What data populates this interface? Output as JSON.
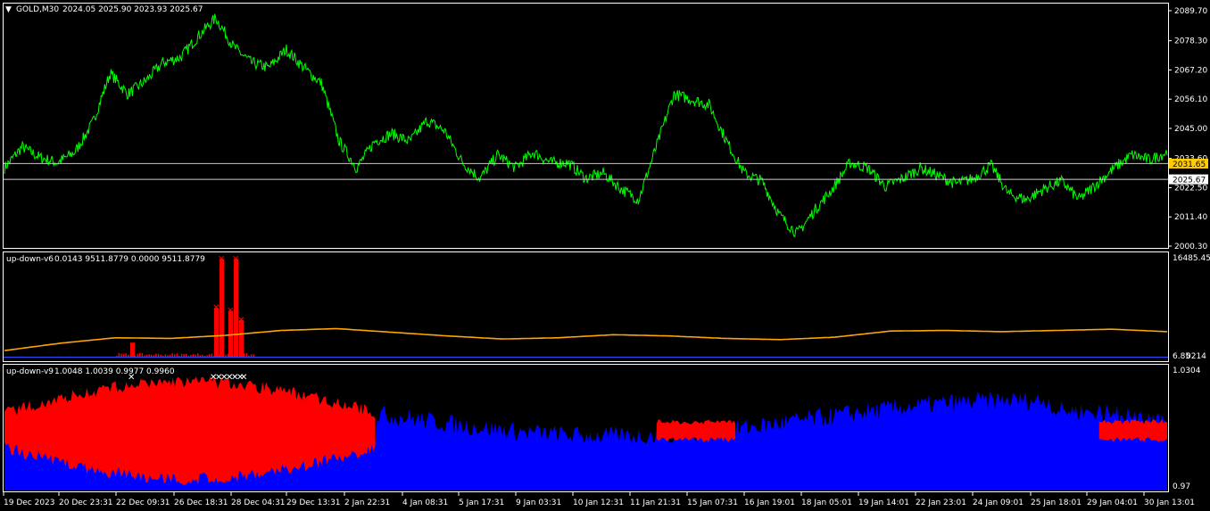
{
  "header": {
    "symbol": "GOLD,M30",
    "ohlc": "2024.05 2025.90 2023.93 2025.67"
  },
  "colors": {
    "background": "#000000",
    "frame": "#ffffff",
    "price_line": "#00ff00",
    "bid_tag": "#ffffff",
    "ref_tag": "#ffcc00",
    "ma_line": "#ffa500",
    "bars_up": "#ff0000",
    "area_blue": "#0000ff",
    "area_red": "#ff0000"
  },
  "chart_data": [
    {
      "type": "line",
      "name": "price",
      "price_scale_ticks": [
        "2089.70",
        "2078.30",
        "2067.20",
        "2056.10",
        "2045.00",
        "2033.60",
        "2022.50",
        "2011.40",
        "2000.30"
      ],
      "ylim": [
        2000.3,
        2089.7
      ],
      "price_tags": {
        "reference": "2031.65",
        "bid": "2025.67"
      },
      "x": [
        "19 Dec 2023",
        "20 Dec 23:31",
        "22 Dec 09:31",
        "26 Dec 18:31",
        "28 Dec 04:31",
        "29 Dec 13:31",
        "2 Jan 22:31",
        "4 Jan 08:31",
        "5 Jan 17:31",
        "9 Jan 03:31",
        "10 Jan 12:31",
        "11 Jan 21:31",
        "15 Jan 07:31",
        "16 Jan 19:01",
        "18 Jan 05:01",
        "19 Jan 14:01",
        "22 Jan 23:01",
        "24 Jan 09:01",
        "25 Jan 18:01",
        "29 Jan 04:01",
        "30 Jan 13:01"
      ],
      "values": [
        2030,
        2038,
        2034,
        2032,
        2036,
        2047,
        2066,
        2058,
        2063,
        2070,
        2072,
        2080,
        2087,
        2076,
        2070,
        2068,
        2075,
        2068,
        2062,
        2040,
        2030,
        2040,
        2043,
        2040,
        2048,
        2044,
        2032,
        2026,
        2035,
        2030,
        2036,
        2032,
        2032,
        2026,
        2028,
        2022,
        2018,
        2038,
        2058,
        2056,
        2054,
        2040,
        2028,
        2025,
        2012,
        2005,
        2014,
        2022,
        2032,
        2030,
        2023,
        2026,
        2030,
        2027,
        2024,
        2026,
        2031,
        2020,
        2018,
        2022,
        2025,
        2018,
        2024,
        2030,
        2035,
        2033,
        2036
      ]
    },
    {
      "type": "bar",
      "name": "up-down-v6",
      "values_text": "0.0143 9511.8779 0.0000 9511.8779",
      "scale_ticks": [
        "16485.450",
        "6.85",
        "0214"
      ],
      "ma_values": [
        1000,
        2200,
        3100,
        3000,
        3500,
        4300,
        4600,
        4000,
        3400,
        2900,
        3100,
        3600,
        3400,
        3000,
        2800,
        3200,
        4200,
        4300,
        4100,
        4300,
        4500,
        4100
      ],
      "bars": [
        {
          "x": "22 Dec 09:31",
          "value": 2300
        },
        {
          "x": "28 Dec 04:31",
          "value": 8000
        },
        {
          "x": "28 Dec 04:31",
          "value": 16000
        },
        {
          "x": "28 Dec 04:31",
          "value": 7500
        },
        {
          "x": "28 Dec 04:31",
          "value": 16000
        },
        {
          "x": "28 Dec 04:31",
          "value": 6000
        }
      ]
    },
    {
      "type": "area",
      "name": "up-down-v9",
      "values_text": "1.0048 1.0039 0.9977 0.9960",
      "scale_ticks": [
        "1.0304",
        "0.97"
      ],
      "ylim": [
        0.97,
        1.0304
      ]
    }
  ]
}
